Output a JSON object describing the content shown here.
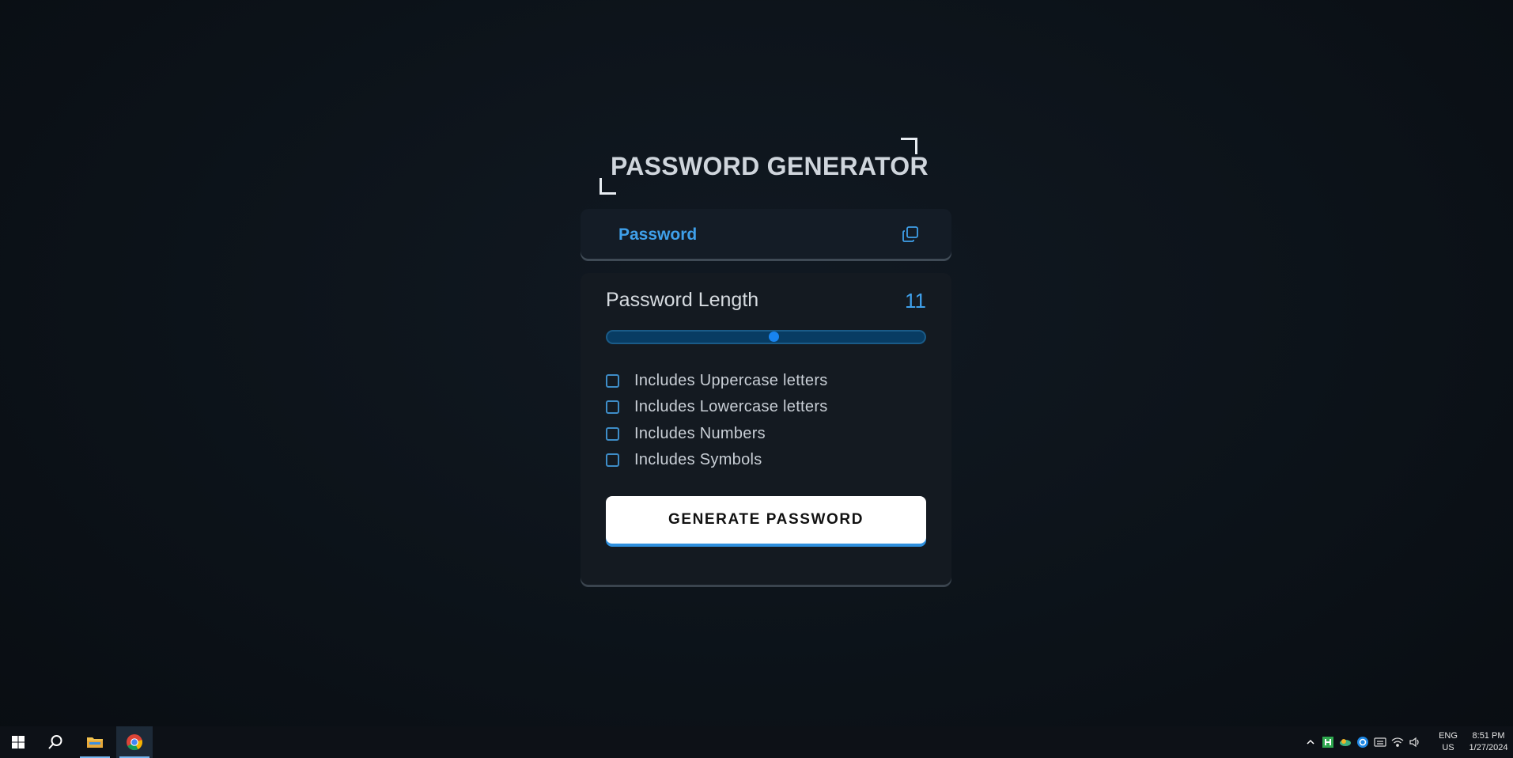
{
  "app": {
    "title": "PASSWORD GENERATOR",
    "password_placeholder": "Password",
    "length": {
      "label": "Password Length",
      "value": "11",
      "slider_fraction": 0.525
    },
    "options": [
      {
        "label": "Includes Uppercase letters",
        "checked": false
      },
      {
        "label": "Includes Lowercase letters",
        "checked": false
      },
      {
        "label": "Includes Numbers",
        "checked": false
      },
      {
        "label": "Includes Symbols",
        "checked": false
      }
    ],
    "generate_label": "GENERATE PASSWORD",
    "colors": {
      "accent": "#3fa0ea",
      "button_bg": "#ffffff",
      "button_underline": "#2f90de",
      "slider_track": "#083c63",
      "slider_thumb": "#1884f0"
    }
  },
  "taskbar": {
    "icons": [
      "windows-start-icon",
      "search-icon",
      "file-explorer-icon",
      "chrome-icon"
    ],
    "tray_icons": [
      "chevron-up-icon",
      "green-h-icon",
      "cloud-icon",
      "q-icon",
      "keyboard-icon",
      "wifi-icon",
      "volume-icon"
    ],
    "lang_line1": "ENG",
    "lang_line2": "US",
    "time": "8:51 PM",
    "date": "1/27/2024"
  }
}
